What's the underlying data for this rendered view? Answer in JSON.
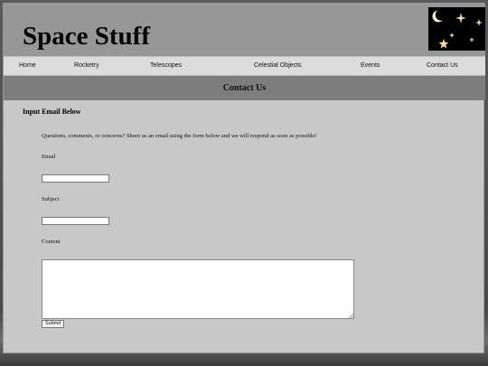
{
  "header": {
    "site_title": "Space Stuff",
    "logo_icon": "night-sky-moon-stars-icon"
  },
  "nav": {
    "items": [
      {
        "label": "Home"
      },
      {
        "label": "Rocketry"
      },
      {
        "label": "Telescopes"
      },
      {
        "label": "Celestial Objects"
      },
      {
        "label": "Events"
      },
      {
        "label": "Contact Us"
      }
    ]
  },
  "banner": {
    "title": "Contact Us"
  },
  "form": {
    "heading": "Input Email Below",
    "intro": "Questions, comments, or concerns? Shoot us an email using the form below and we will respond as soon as possible!",
    "email_label": "Email",
    "email_value": "",
    "subject_label": "Subject",
    "subject_value": "",
    "content_label": "Content",
    "content_value": "",
    "submit_label": "Submit"
  },
  "colors": {
    "header_bg": "#979797",
    "banner_bg": "#7d7d7d",
    "page_bg": "#c8c8c8",
    "nav_bg": "#dcdcdc",
    "star": "#f3df9a"
  }
}
